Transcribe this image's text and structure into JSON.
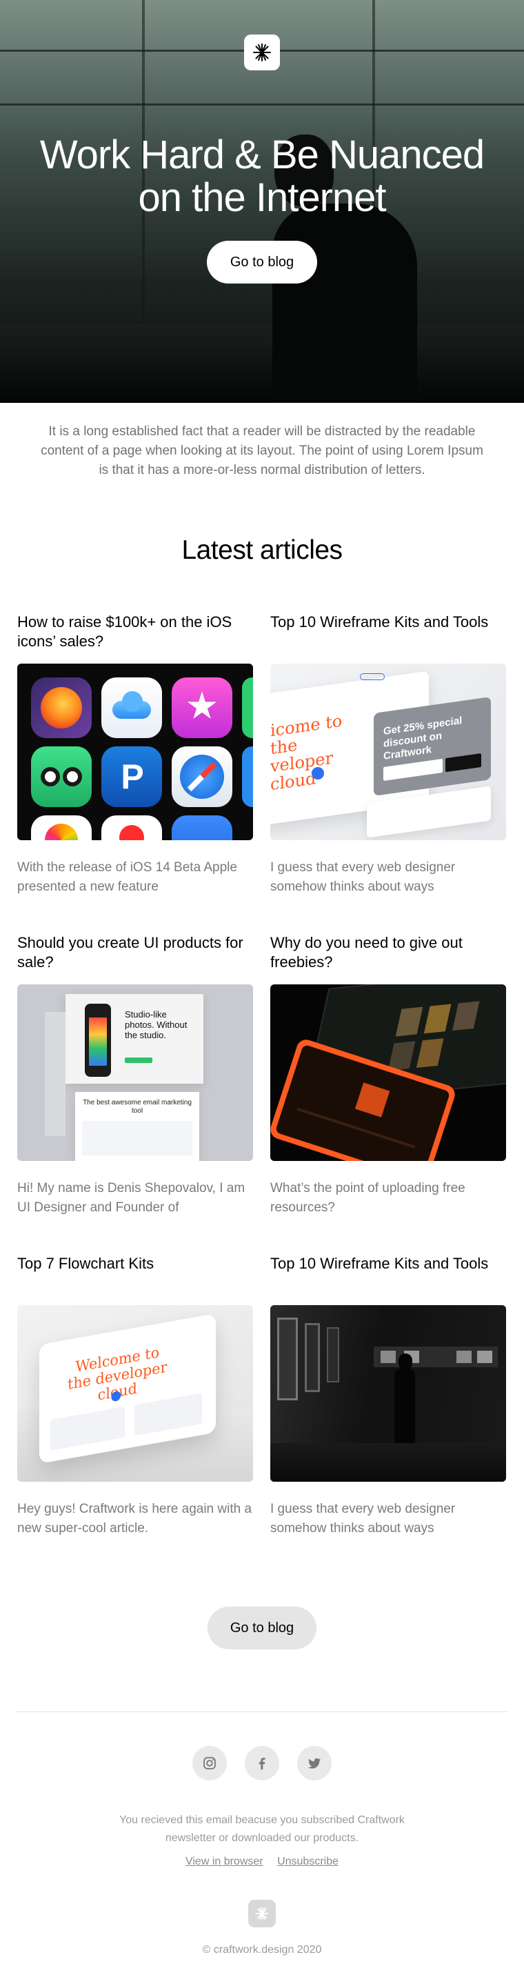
{
  "hero": {
    "title_line1": "Work Hard & Be Nuanced",
    "title_line2": "on the Internet",
    "cta_label": "Go to blog"
  },
  "intro": {
    "text": "It is a long established fact that a reader will be distracted by the readable content of a page when looking at its layout. The point of using Lorem Ipsum is that it has a more-or-less normal distribution of letters."
  },
  "section_title": "Latest articles",
  "articles": [
    {
      "title": "How to raise $100k+ on the iOS icons’ sales?",
      "excerpt": "With the release of iOS 14 Beta Apple presented a new feature"
    },
    {
      "title": "Top 10 Wireframe Kits and Tools",
      "excerpt": "I guess that every web designer somehow thinks about ways"
    },
    {
      "title": "Should you create UI products for sale?",
      "excerpt": "Hi! My name is Denis Shepovalov, I am UI Designer and Founder of"
    },
    {
      "title": "Why do you need to give out freebies?",
      "excerpt": "What’s the point of uploading free resources?"
    },
    {
      "title": "Top 7 Flowchart Kits",
      "excerpt": "Hey guys! Craftwork is here again with a new super-cool article."
    },
    {
      "title": "Top 10 Wireframe Kits and Tools",
      "excerpt": "I guess that every web designer somehow thinks about ways"
    }
  ],
  "thumb_text": {
    "wire1_headline": "icome to the veloper cloud",
    "wire1_promo": "Get 25% special discount on Craftwork",
    "ui_headline": "Studio-like photos. Without the studio.",
    "ui_sub": "The best awesome email marketing tool",
    "wire2_headline": "Welcome to the developer cloud"
  },
  "blog_button_label": "Go to blog",
  "social": [
    "instagram-icon",
    "facebook-icon",
    "twitter-icon"
  ],
  "footer": {
    "notice": "You recieved this email beacuse you subscribed Craftwork newsletter or downloaded our products.",
    "view_in_browser": "View in browser",
    "unsubscribe": "Unsubscribe",
    "copyright": "© craftwork.design 2020"
  },
  "colors": {
    "accent_orange": "#ff5a1f",
    "brand_blue": "#2b6ff2",
    "muted_text": "#7a7a7a"
  }
}
